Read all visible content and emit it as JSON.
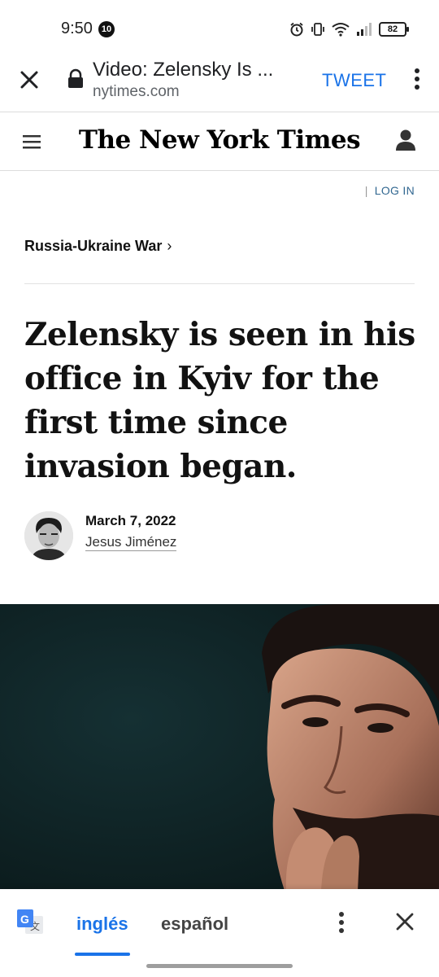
{
  "status_bar": {
    "time": "9:50",
    "notification_count": "10",
    "battery_level": "82",
    "icons": [
      "alarm-icon",
      "vibrate-icon",
      "wifi-icon",
      "cell-signal-icon",
      "battery-icon"
    ]
  },
  "browser": {
    "page_title": "Video: Zelensky Is ...",
    "url": "nytimes.com",
    "action_label": "TWEET",
    "accent_color": "#1a73e8"
  },
  "site_header": {
    "logo_text": "The New York Times"
  },
  "login": {
    "label": "LOG IN"
  },
  "article": {
    "kicker": "Russia-Ukraine War",
    "headline": "Zelensky is seen in his office in Kyiv for the first time since invasion began.",
    "date": "March 7, 2022",
    "author": "Jesus Jiménez"
  },
  "translate_bar": {
    "source_language": "inglés",
    "target_language": "español",
    "active_color": "#1a73e8"
  }
}
